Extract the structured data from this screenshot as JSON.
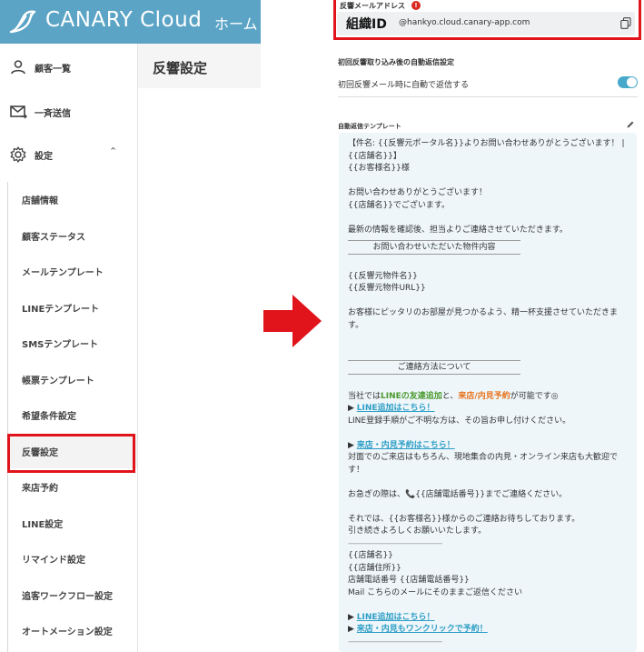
{
  "app": {
    "brand": "CANARY Cloud",
    "home_link": "ホーム",
    "page_title": "反響設定"
  },
  "sidebar": {
    "customers": "顧客一覧",
    "bulk_send": "一斉送信",
    "settings": "設定",
    "sub_items": [
      "店舗情報",
      "顧客ステータス",
      "メールテンプレート",
      "LINEテンプレート",
      "SMSテンプレート",
      "帳票テンプレート",
      "希望条件設定",
      "反響設定",
      "来店予約",
      "LINE設定",
      "リマインド設定",
      "追客ワークフロー設定",
      "オートメーション設定"
    ],
    "active_item": "反響設定"
  },
  "settings": {
    "email_label": "反響メールアドレス",
    "alert_glyph": "!",
    "org_id": "組織ID",
    "email_domain": "@hankyo.cloud.canary-app.com",
    "auto_reply_heading": "初回反響取り込み後の自動返信設定",
    "auto_reply_label": "初回反響メール時に自動で返信する",
    "auto_reply_enabled": true,
    "template_label": "自動返信テンプレート"
  },
  "template": {
    "subject_1": "【件名: {{反響元ポータル名}}よりお問い合わせありがとうございます！ | ",
    "subject_2": "{{店舗名}}】",
    "greeting": "{{お客様名}}様",
    "thanks": "お問い合わせありがとうございます！",
    "store_intro": "{{店舗名}}でございます。",
    "confirm": "最新の情報を確認後、担当よりご連絡させていただきます。",
    "section_property": "お問い合わせいただいた物件内容",
    "property_name": "{{反響元物件名}}",
    "property_url": "{{反響元物件URL}}",
    "support": "お客様にピッタリのお部屋が見つかるよう、精一杯支援させていただきます。",
    "section_contact": "ご連絡方法について",
    "intro_pre": "当社では",
    "line_friend": "LINEの友達追加",
    "intro_mid": "と、",
    "visit_reserve": "来店/内見予約",
    "intro_post": "が可能です◎",
    "bullet": "▶",
    "line_link": "LINE追加はこちら！",
    "line_note": "LINE登録手順がご不明な方は、その旨お申し付けください。",
    "visit_link": "来店・内見予約はこちら！",
    "visit_note": "対面でのご来店はもちろん、現地集合の内見・オンライン来店も大歓迎です！",
    "urgent_pre": "お急ぎの際は、",
    "phone_glyph": "📞",
    "urgent_phone": "{{店舗電話番号}}",
    "urgent_post": "までご連絡ください。",
    "closing_1": "それでは、{{お客様名}}様からのご連絡お待ちしております。",
    "closing_2": "引き続きよろしくお願いいたします。",
    "separator": "----------------------------------------------",
    "sig_store": "{{店舗名}}",
    "sig_address": "{{店舗住所}}",
    "sig_phone": "店舗電話番号 {{店舗電話番号}}",
    "sig_mail": "Mail こちらのメールにそのままご返信ください",
    "line_link_2": "LINE追加はこちら！",
    "oneclick_link": "来店・内見もワンクリックで予約！"
  },
  "colors": {
    "brand": "#5ba4c6",
    "highlight_red": "#e1141b",
    "toggle": "#47a8c9",
    "template_bg": "#eef6fa"
  },
  "icons": {
    "logo": "bird-icon",
    "customers": "person-icon",
    "bulk_send": "mail-send-icon",
    "settings": "gear-icon",
    "expand": "chevron-up-icon",
    "copy": "copy-icon",
    "edit": "pencil-icon",
    "arrow": "right-arrow-icon"
  }
}
